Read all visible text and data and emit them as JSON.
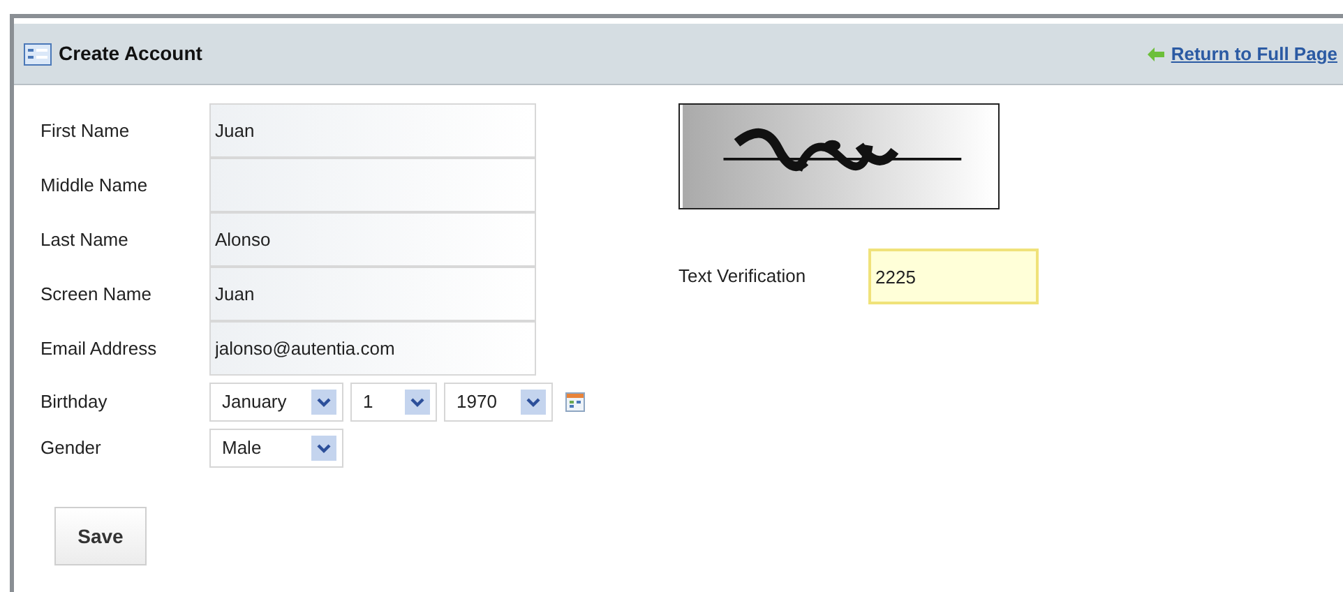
{
  "header": {
    "title": "Create Account",
    "return_link": "Return to Full Page"
  },
  "fields": [
    {
      "label": "First Name",
      "value": "Juan"
    },
    {
      "label": "Middle Name"
    },
    {
      "label": "Last Name",
      "value": "Alonso"
    },
    {
      "label": "Screen Name",
      "value": "Juan"
    },
    {
      "label": "Email Address",
      "value": "jalonso@autentia.com"
    }
  ],
  "birthday": {
    "label": "Birthday",
    "month": "January",
    "day": "1",
    "year": "1970"
  },
  "gender": {
    "label": "Gender",
    "value": "Male"
  },
  "save_button": "Save",
  "verification": {
    "label": "Text Verification",
    "value": "2225"
  }
}
